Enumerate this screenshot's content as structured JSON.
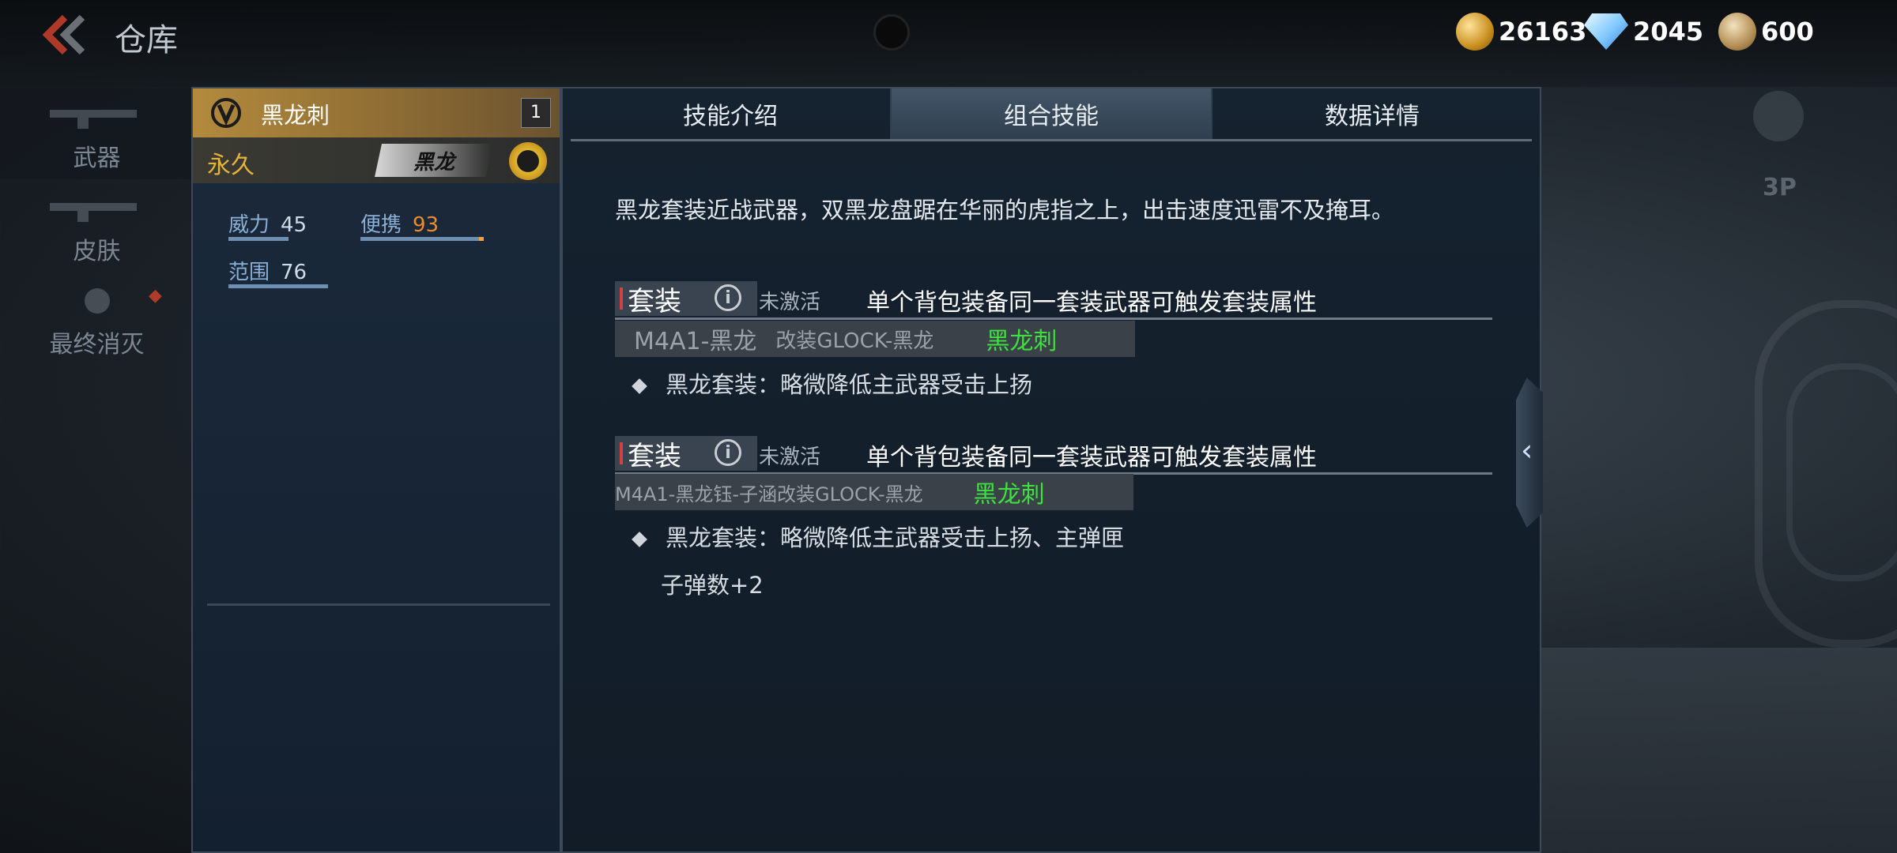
{
  "header": {
    "title": "仓库"
  },
  "currency": [
    {
      "icon": "gold-coin-icon",
      "value": "26163"
    },
    {
      "icon": "diamond-icon",
      "value": "2045"
    },
    {
      "icon": "medal-icon",
      "value": "600"
    }
  ],
  "sidebar": {
    "items": [
      {
        "label": "武器"
      },
      {
        "label": "皮肤"
      },
      {
        "label": "最终消灭"
      }
    ]
  },
  "item": {
    "name": "黑龙刺",
    "count": "1",
    "duration": "永久",
    "badge": "黑龙",
    "stats": [
      {
        "label": "威力",
        "value": "45"
      },
      {
        "label": "便携",
        "value": "93"
      },
      {
        "label": "范围",
        "value": "76"
      }
    ]
  },
  "tabs": [
    {
      "label": "技能介绍"
    },
    {
      "label": "组合技能"
    },
    {
      "label": "数据详情"
    }
  ],
  "detail": {
    "description": "黑龙套装近战武器，双黑龙盘踞在华丽的虎指之上，出击速度迅雷不及掩耳。",
    "sets": [
      {
        "tag": "套装",
        "status": "未激活",
        "rule": "单个背包装备同一套装武器可触发套装属性",
        "parts": [
          "M4A1-黑龙",
          "改装GLOCK-黑龙",
          "黑龙刺"
        ],
        "bonus_lines": [
          "黑龙套装：略微降低主武器受击上扬"
        ]
      },
      {
        "tag": "套装",
        "status": "未激活",
        "rule": "单个背包装备同一套装武器可触发套装属性",
        "parts": [
          "M4A1-黑龙钰-子涵",
          "改装GLOCK-黑龙",
          "黑龙刺"
        ],
        "bonus_lines": [
          "黑龙套装：略微降低主武器受击上扬、主弹匣",
          "子弹数+2"
        ]
      }
    ]
  },
  "right_hud": {
    "view_label": "3P"
  },
  "colors": {
    "active_part": "#3ee03e",
    "accent_gold": "#e8b33b",
    "portable_value": "#f08a2a"
  }
}
